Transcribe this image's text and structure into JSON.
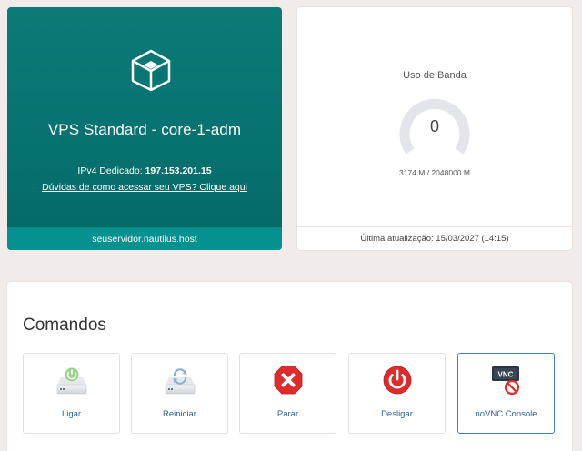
{
  "vps": {
    "title": "VPS Standard - core-1-adm",
    "ip_label": "IPv4 Dedicado: ",
    "ip_value": "197.153.201.15",
    "help_link": "Dúvidas de como acessar seu VPS? Clique aqui",
    "hostname": "seuservidor.nautilus.host",
    "icon": "cube-icon"
  },
  "bandwidth": {
    "title": "Uso de Banda",
    "gauge_value": "0",
    "gauge_percent": 0,
    "usage_text": "3174 M / 2048000 M",
    "last_update": "Última atualização: 15/03/2027 (14:15)"
  },
  "commands": {
    "title": "Comandos",
    "buttons": [
      {
        "label": "Ligar",
        "icon": "server-power-on-icon"
      },
      {
        "label": "Reiniciar",
        "icon": "server-restart-icon"
      },
      {
        "label": "Parar",
        "icon": "stop-icon"
      },
      {
        "label": "Desligar",
        "icon": "power-off-icon"
      },
      {
        "label": "noVNC Console",
        "icon": "vnc-disabled-icon",
        "icon_text": "VNC"
      }
    ]
  },
  "colors": {
    "vps_card": "#077170",
    "accent_link": "#2a5f9e",
    "active_border": "#3a7fcf",
    "stop_red": "#e02b2b"
  }
}
